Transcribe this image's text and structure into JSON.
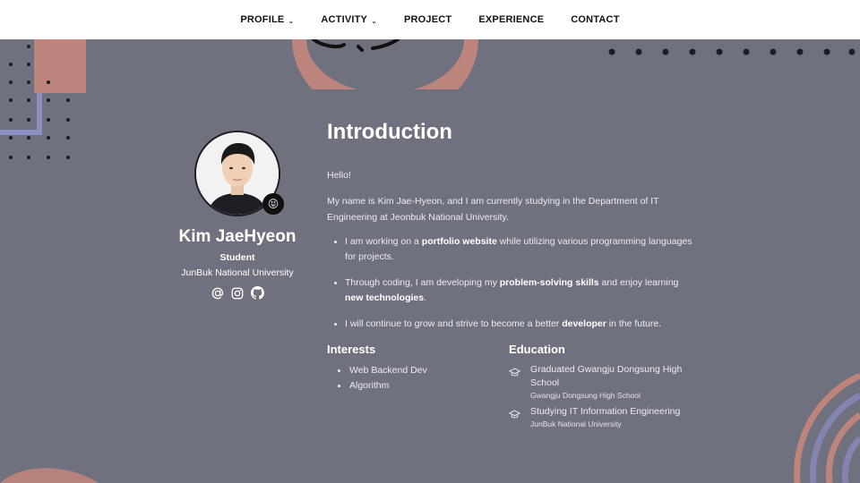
{
  "nav": {
    "items": [
      {
        "label": "PROFILE",
        "dropdown": true
      },
      {
        "label": "ACTIVITY",
        "dropdown": true
      },
      {
        "label": "PROJECT",
        "dropdown": false
      },
      {
        "label": "EXPERIENCE",
        "dropdown": false
      },
      {
        "label": "CONTACT",
        "dropdown": false
      }
    ],
    "chevron_glyph": "⌄"
  },
  "profile": {
    "name": "Kim JaeHyeon",
    "role": "Student",
    "university": "JunBuk National University",
    "badge_emoji": "😝",
    "social_icons": [
      "at-sign-icon",
      "instagram-icon",
      "github-icon"
    ]
  },
  "intro": {
    "title": "Introduction",
    "greeting": "Hello!",
    "paragraph": "My name is Kim Jae-Hyeon, and I am currently studying in the Department of IT Engineering at Jeonbuk National University.",
    "bullets": [
      {
        "before": "I am working on a ",
        "bold": "portfolio website",
        "after": " while utilizing various programming languages for projects."
      },
      {
        "before": "Through coding, I am developing my ",
        "bold": "problem-solving skills",
        "after": " and enjoy learning ",
        "bold2": "new technologies",
        "after2": "."
      },
      {
        "before": "I will continue to grow and strive to become a better ",
        "bold": "developer",
        "after": " in the future."
      }
    ]
  },
  "interests": {
    "title": "Interests",
    "items": [
      "Web Backend Dev",
      "Algorithm"
    ]
  },
  "education": {
    "title": "Education",
    "items": [
      {
        "main": "Graduated Gwangju Dongsung High School",
        "sub": "Gwangju Dongsung High School"
      },
      {
        "main": "Studying IT Information Engineering",
        "sub": "JunBuk National University"
      }
    ]
  },
  "colors": {
    "background": "#70717f",
    "nav_background": "#ffffff",
    "accent_salmon": "#c9877a",
    "accent_lavender": "#8c8fc4",
    "dot": "#1c1d28"
  }
}
